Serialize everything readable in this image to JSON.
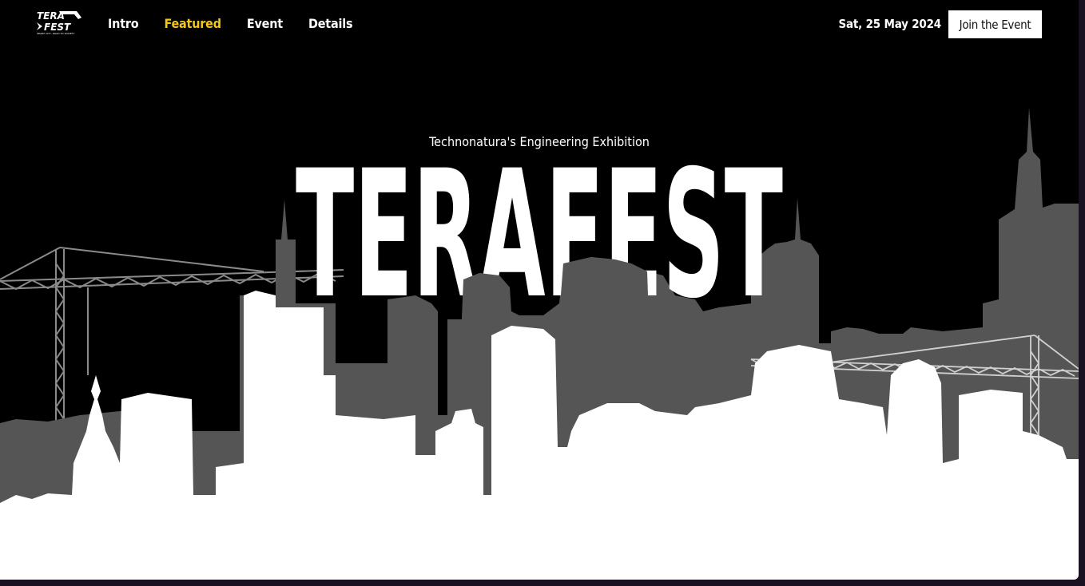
{
  "logo": {
    "top_text": "TERA",
    "bottom_text": "FEST",
    "tagline": "SMART CITY, ROAD TO SOCIETY"
  },
  "nav": {
    "links": [
      {
        "label": "Intro",
        "active": false
      },
      {
        "label": "Featured",
        "active": true
      },
      {
        "label": "Event",
        "active": false
      },
      {
        "label": "Details",
        "active": false
      }
    ],
    "date": "Sat, 25 May 2024",
    "join_label": "Join the Event"
  },
  "hero": {
    "subtitle": "Technonatura's Engineering Exhibition",
    "title": "TERAFEST"
  },
  "colors": {
    "background": "#000000",
    "accent": "#f5c518",
    "skyline_back": "#555555",
    "skyline_front": "#ffffff"
  }
}
